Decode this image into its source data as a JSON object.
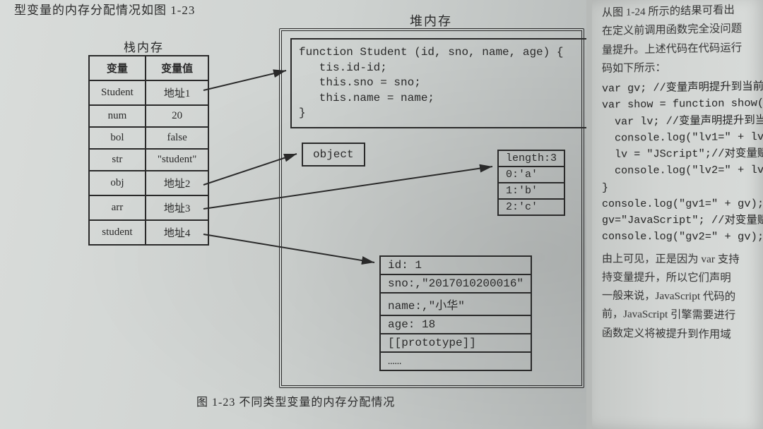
{
  "top_fragment": "型变量的内存分配情况如图 1-23",
  "stack": {
    "title": "栈内存",
    "headers": [
      "变量",
      "变量值"
    ],
    "rows": [
      {
        "var": "Student",
        "val": "地址1"
      },
      {
        "var": "num",
        "val": "20"
      },
      {
        "var": "bol",
        "val": "false"
      },
      {
        "var": "str",
        "val": "\"student\""
      },
      {
        "var": "obj",
        "val": "地址2"
      },
      {
        "var": "arr",
        "val": "地址3"
      },
      {
        "var": "student",
        "val": "地址4"
      }
    ]
  },
  "heap": {
    "title": "堆内存",
    "func_code": "function Student (id, sno, name, age) {\n   tis.id-id;\n   this.sno = sno;\n   this.name = name;\n}",
    "object_label": "object",
    "array": {
      "header": "length:3",
      "items": [
        "0:'a'",
        "1:'b'",
        "2:'c'"
      ]
    },
    "instance": {
      "rows": [
        "id: 1",
        "sno:,\"2017010200016\"",
        "name:,\"小华\"",
        "age: 18",
        "[[prototype]]",
        "……"
      ]
    }
  },
  "caption": "图 1-23  不同类型变量的内存分配情况",
  "right_page": {
    "line1": "从图 1-24 所示的结果可看出",
    "line2": "在定义前调用函数完全没问题",
    "line3": "量提升。上述代码在代码运行",
    "line4": "码如下所示：",
    "code1": "var gv; //变量声明提升到当前作\nvar show = function show(){\n  var lv; //变量声明提升到当前\n  console.log(\"lv1=\" + lv);//\n  lv = \"JScript\";//对变量赋值\n  console.log(\"lv2=\" + lv);//\n}\nconsole.log(\"gv1=\" + gv);//\ngv=\"JavaScript\"; //对变量赋值\nconsole.log(\"gv2=\" + gv);//",
    "line5": "由上可见，正是因为 var 支持",
    "line6": "持变量提升，所以它们声明",
    "line7": "一般来说，JavaScript 代码的",
    "line8": "前，JavaScript 引擎需要进行",
    "line9": "函数定义将被提升到作用域"
  }
}
